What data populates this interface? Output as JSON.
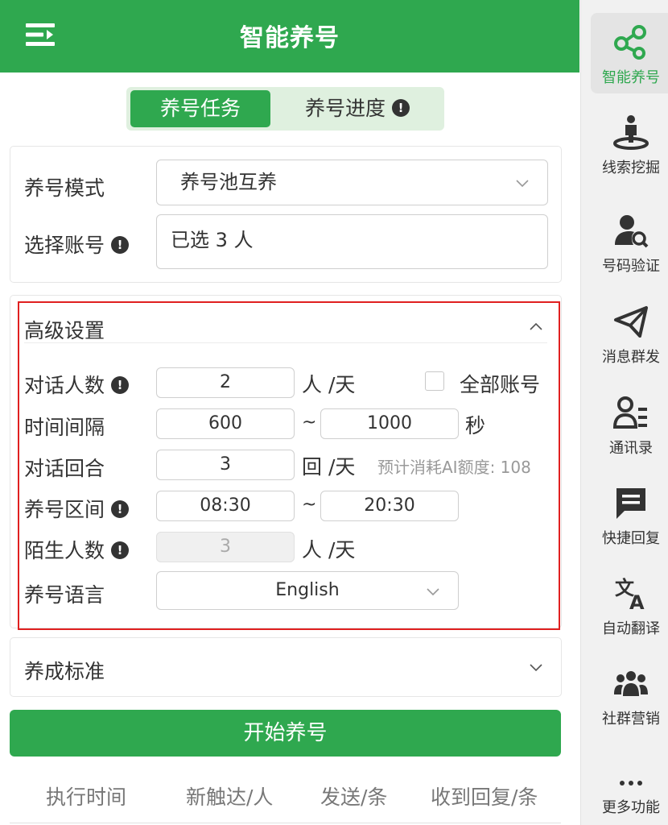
{
  "header": {
    "title": "智能养号"
  },
  "tabs": {
    "task": "养号任务",
    "progress": "养号进度"
  },
  "basic": {
    "mode_label": "养号模式",
    "mode_value": "养号池互养",
    "account_label": "选择账号",
    "account_value": "已选 3 人"
  },
  "advanced": {
    "title": "高级设置",
    "chat_count_label": "对话人数",
    "chat_count_value": "2",
    "chat_count_unit": "人 /天",
    "all_accounts_label": "全部账号",
    "interval_label": "时间间隔",
    "interval_min": "600",
    "interval_max": "1000",
    "interval_unit": "秒",
    "tilde": "~",
    "rounds_label": "对话回合",
    "rounds_value": "3",
    "rounds_unit": "回 /天",
    "estimate_text": "预计消耗AI额度: 108",
    "period_label": "养号区间",
    "period_start": "08:30",
    "period_end": "20:30",
    "stranger_label": "陌生人数",
    "stranger_value": "3",
    "stranger_unit": "人 /天",
    "language_label": "养号语言",
    "language_value": "English"
  },
  "standard": {
    "title": "养成标准"
  },
  "start_button": "开始养号",
  "stats": {
    "exec_time": "执行时间",
    "new_reach": "新触达/人",
    "sent": "发送/条",
    "replies": "收到回复/条"
  },
  "sidebar": {
    "items": [
      {
        "label": "智能养号",
        "icon": "share-nodes-icon"
      },
      {
        "label": "线索挖掘",
        "icon": "person-pin-icon"
      },
      {
        "label": "号码验证",
        "icon": "user-search-icon"
      },
      {
        "label": "消息群发",
        "icon": "paper-plane-icon"
      },
      {
        "label": "通讯录",
        "icon": "contacts-icon"
      },
      {
        "label": "快捷回复",
        "icon": "message-icon"
      },
      {
        "label": "自动翻译",
        "icon": "translate-icon"
      },
      {
        "label": "社群营销",
        "icon": "group-icon"
      },
      {
        "label": "更多功能",
        "icon": "more-icon"
      }
    ]
  },
  "colors": {
    "brand": "#2fa84f",
    "highlight_border": "#e02020"
  }
}
